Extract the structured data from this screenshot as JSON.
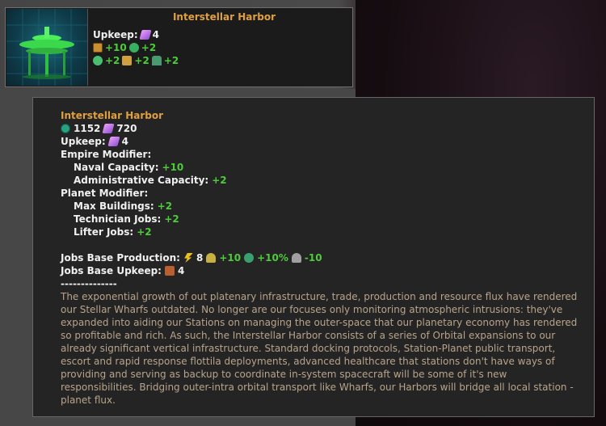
{
  "card": {
    "title": "Interstellar Harbor",
    "upkeep_label": "Upkeep:",
    "upkeep_value": "4",
    "line2": [
      "+10",
      "+2"
    ],
    "line3": [
      "+2",
      "+2",
      "+2"
    ]
  },
  "tooltip": {
    "title": "Interstellar Harbor",
    "cost_a": "1152",
    "cost_b": "720",
    "upkeep_label": "Upkeep:",
    "upkeep_value": "4",
    "empire_modifier": "Empire Modifier:",
    "naval_label": "Naval Capacity:",
    "naval_value": "+10",
    "admin_label": "Administrative Capacity:",
    "admin_value": "+2",
    "planet_modifier": "Planet Modifier:",
    "maxb_label": "Max Buildings:",
    "maxb_value": "+2",
    "tech_label": "Technician Jobs:",
    "tech_value": "+2",
    "lifter_label": "Lifter Jobs:",
    "lifter_value": "+2",
    "prod_label": "Jobs Base Production:",
    "prod_energy": "8",
    "prod_worker": "+10",
    "prod_pop": "+10%",
    "prod_crime": "-10",
    "jupkeep_label": "Jobs Base Upkeep:",
    "jupkeep_value": "4",
    "separator": "--------------",
    "description": "The exponential growth of out platenary infrastructure, trade, production and resource flux have rendered our Stellar Wharfs outdated. No longer are our focuses only monitoring atmospheric intrusions: they've expanded into aiding our Stations on managing the outer-space that our planetary economy has rendered so profitable and rich. As such, the Interstellar Harbor consists of a series of Orbital expansions to our already significant vertical infrastructure. Standard docking protocols, Station-Planet public transport, escort and rapid response flottila deployments, advanced healthcare that stations don't have ways of providing and serving as backup to coordinate in-system spacecraft will be some of it's new responsibilities. Bridging outer-intra orbital transport like Wharfs, our Harbors will bridge all local station - planet flux."
  },
  "colors": {
    "title": "#e0a040",
    "positive": "#4ecb3a",
    "description": "#b8a48a"
  }
}
